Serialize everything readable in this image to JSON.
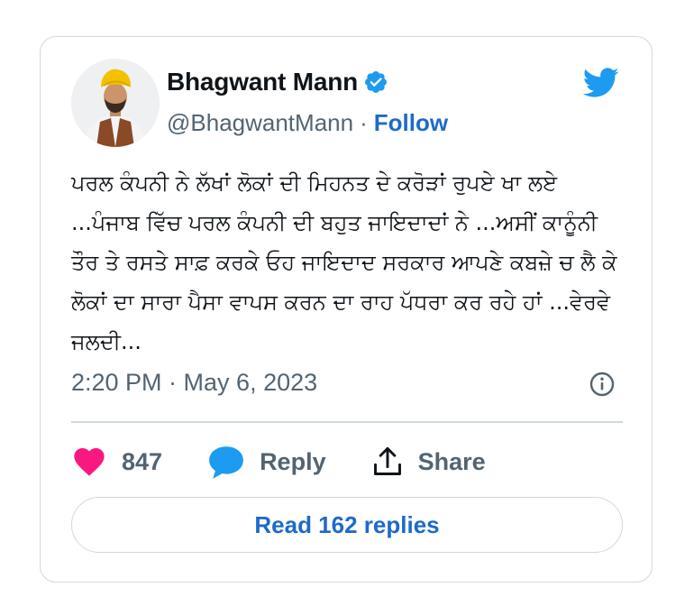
{
  "author": {
    "name": "Bhagwant Mann",
    "handle": "@BhagwantMann",
    "separator": "·",
    "follow_label": "Follow",
    "verified_icon": "verified-badge-icon"
  },
  "tweet": {
    "text": "ਪਰਲ ਕੰਪਨੀ ਨੇ ਲੱਖਾਂ ਲੋਕਾਂ ਦੀ ਮਿਹਨਤ ਦੇ ਕਰੋੜਾਂ ਰੁਪਏ ਖਾ ਲਏ ...ਪੰਜਾਬ ਵਿੱਚ ਪਰਲ ਕੰਪਨੀ ਦੀ ਬਹੁਤ ਜਾਇਦਾਦਾਂ ਨੇ ...ਅਸੀਂ ਕਾਨੂੰਨੀ ਤੌਰ ਤੇ ਰਸਤੇ ਸਾਫ਼ ਕਰਕੇ ਓਹ ਜਾਇਦਾਦ ਸਰਕਾਰ ਆਪਣੇ ਕਬਜ਼ੇ ਚ ਲੈ ਕੇ ਲੋਕਾਂ ਦਾ ਸਾਰਾ ਪੈਸਾ ਵਾਪਸ ਕਰਨ ਦਾ ਰਾਹ ਪੱਧਰਾ ਕਰ ਰਹੇ ਹਾਂ ...ਵੇਰਵੇ ਜਲਦੀ...",
    "timestamp": "2:20 PM · May 6, 2023"
  },
  "actions": {
    "likes_count": "847",
    "reply_label": "Reply",
    "share_label": "Share"
  },
  "read_replies_label": "Read 162 replies",
  "icons": [
    "twitter-bird-icon",
    "info-icon",
    "heart-icon",
    "reply-bubble-icon",
    "share-icon"
  ],
  "colors": {
    "accent": "#1d9bf0",
    "link": "#1d6bc9",
    "like": "#f91880",
    "muted": "#536471",
    "border": "#cfd9de"
  }
}
